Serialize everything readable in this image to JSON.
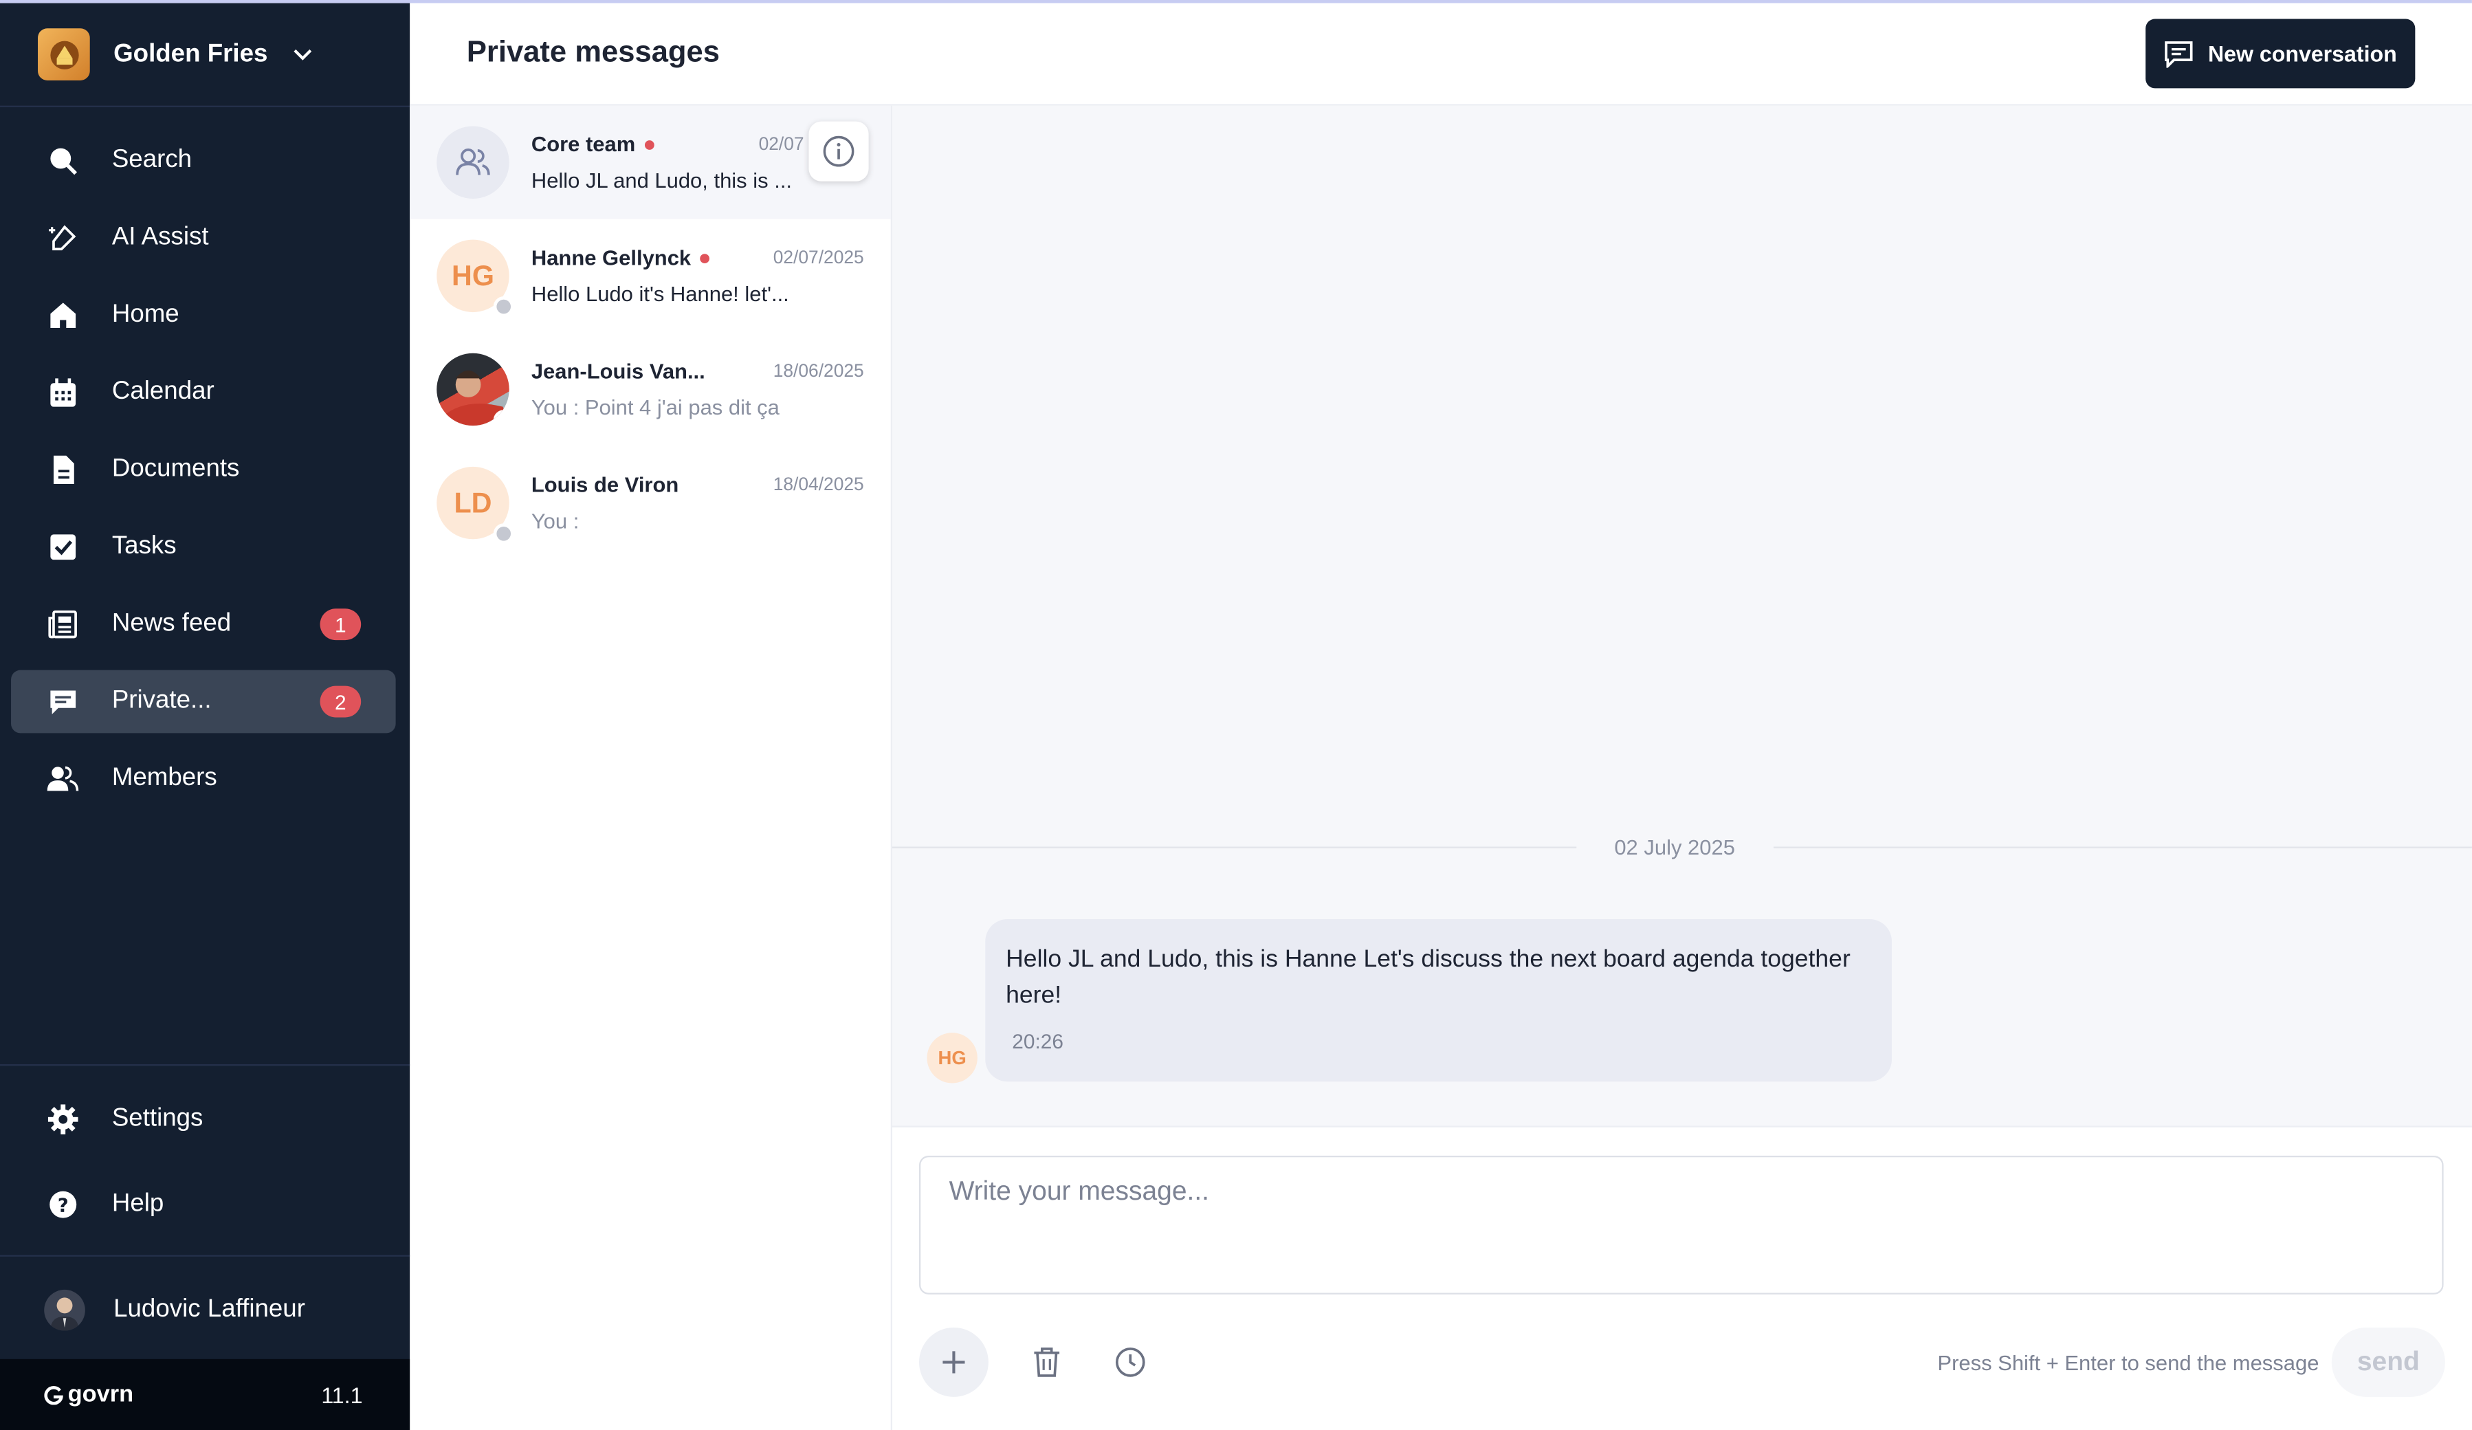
{
  "org": {
    "name": "Golden Fries"
  },
  "nav": {
    "search": "Search",
    "ai": "AI Assist",
    "home": "Home",
    "calendar": "Calendar",
    "documents": "Documents",
    "tasks": "Tasks",
    "news": "News feed",
    "news_badge": "1",
    "private": "Private...",
    "private_badge": "2",
    "members": "Members",
    "settings": "Settings",
    "help": "Help"
  },
  "user": {
    "name": "Ludovic Laffineur"
  },
  "footer": {
    "brand": "govrn",
    "version": "11.1"
  },
  "header": {
    "title": "Private messages",
    "new_button": "New conversation"
  },
  "conversations": [
    {
      "name": "Core team",
      "date": "02/07",
      "preview": "Hello JL and Ludo, this is ..."
    },
    {
      "name": "Hanne Gellynck",
      "initials": "HG",
      "date": "02/07/2025",
      "preview": "Hello Ludo it's Hanne! let'..."
    },
    {
      "name": "Jean-Louis Van...",
      "date": "18/06/2025",
      "preview": "You : Point 4 j'ai pas dit ça"
    },
    {
      "name": "Louis de Viron",
      "initials": "LD",
      "date": "18/04/2025",
      "preview": "You :"
    }
  ],
  "chat": {
    "date_separator": "02 July 2025",
    "message": {
      "initials": "HG",
      "text": "Hello JL and Ludo, this is Hanne Let's discuss the next board agenda together here!",
      "time": "20:26"
    }
  },
  "composer": {
    "placeholder": "Write your message...",
    "hint": "Press Shift + Enter to send the message",
    "send": "send"
  },
  "colors": {
    "sidebar": "#141f30",
    "accent": "#141f30",
    "badge": "#e0535a",
    "initials": "#ed8f4d"
  }
}
